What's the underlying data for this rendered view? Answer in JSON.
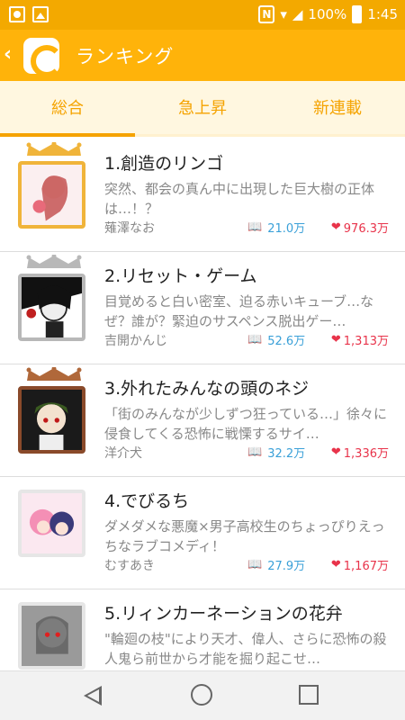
{
  "status_bar": {
    "battery": "100%",
    "time": "1:45"
  },
  "app_bar": {
    "title": "ランキング"
  },
  "tabs": [
    {
      "label": "総合",
      "active": true
    },
    {
      "label": "急上昇",
      "active": false
    },
    {
      "label": "新連載",
      "active": false
    }
  ],
  "items": [
    {
      "title": "1.創造のリンゴ",
      "description": "突然、都会の真ん中に出現した巨大樹の正体は…！？",
      "author": "薙澤なお",
      "views": "21.0万",
      "likes": "976.3万",
      "crown_color": "#f0b43a"
    },
    {
      "title": "2.リセット・ゲーム",
      "description": "目覚めると白い密室、迫る赤いキューブ…なぜ？誰が？緊迫のサスペンス脱出ゲー…",
      "author": "吉開かんじ",
      "views": "52.6万",
      "likes": "1,313万",
      "crown_color": "#b8b8b8"
    },
    {
      "title": "3.外れたみんなの頭のネジ",
      "description": "「街のみんなが少しずつ狂っている…」徐々に侵食してくる恐怖に戦慄するサイ…",
      "author": "洋介犬",
      "views": "32.2万",
      "likes": "1,336万",
      "crown_color": "#b0683a"
    },
    {
      "title": "4.でびるち",
      "description": "ダメダメな悪魔×男子高校生のちょっぴりえっちなラブコメディ！",
      "author": "むすあき",
      "views": "27.9万",
      "likes": "1,167万",
      "crown_color": ""
    },
    {
      "title": "5.リィンカーネーションの花弁",
      "description": "\"輪廻の枝\"により天才、偉人、さらに恐怖の殺人鬼ら前世から才能を掘り起こせ…",
      "author": "",
      "views": "",
      "likes": "",
      "crown_color": ""
    }
  ]
}
